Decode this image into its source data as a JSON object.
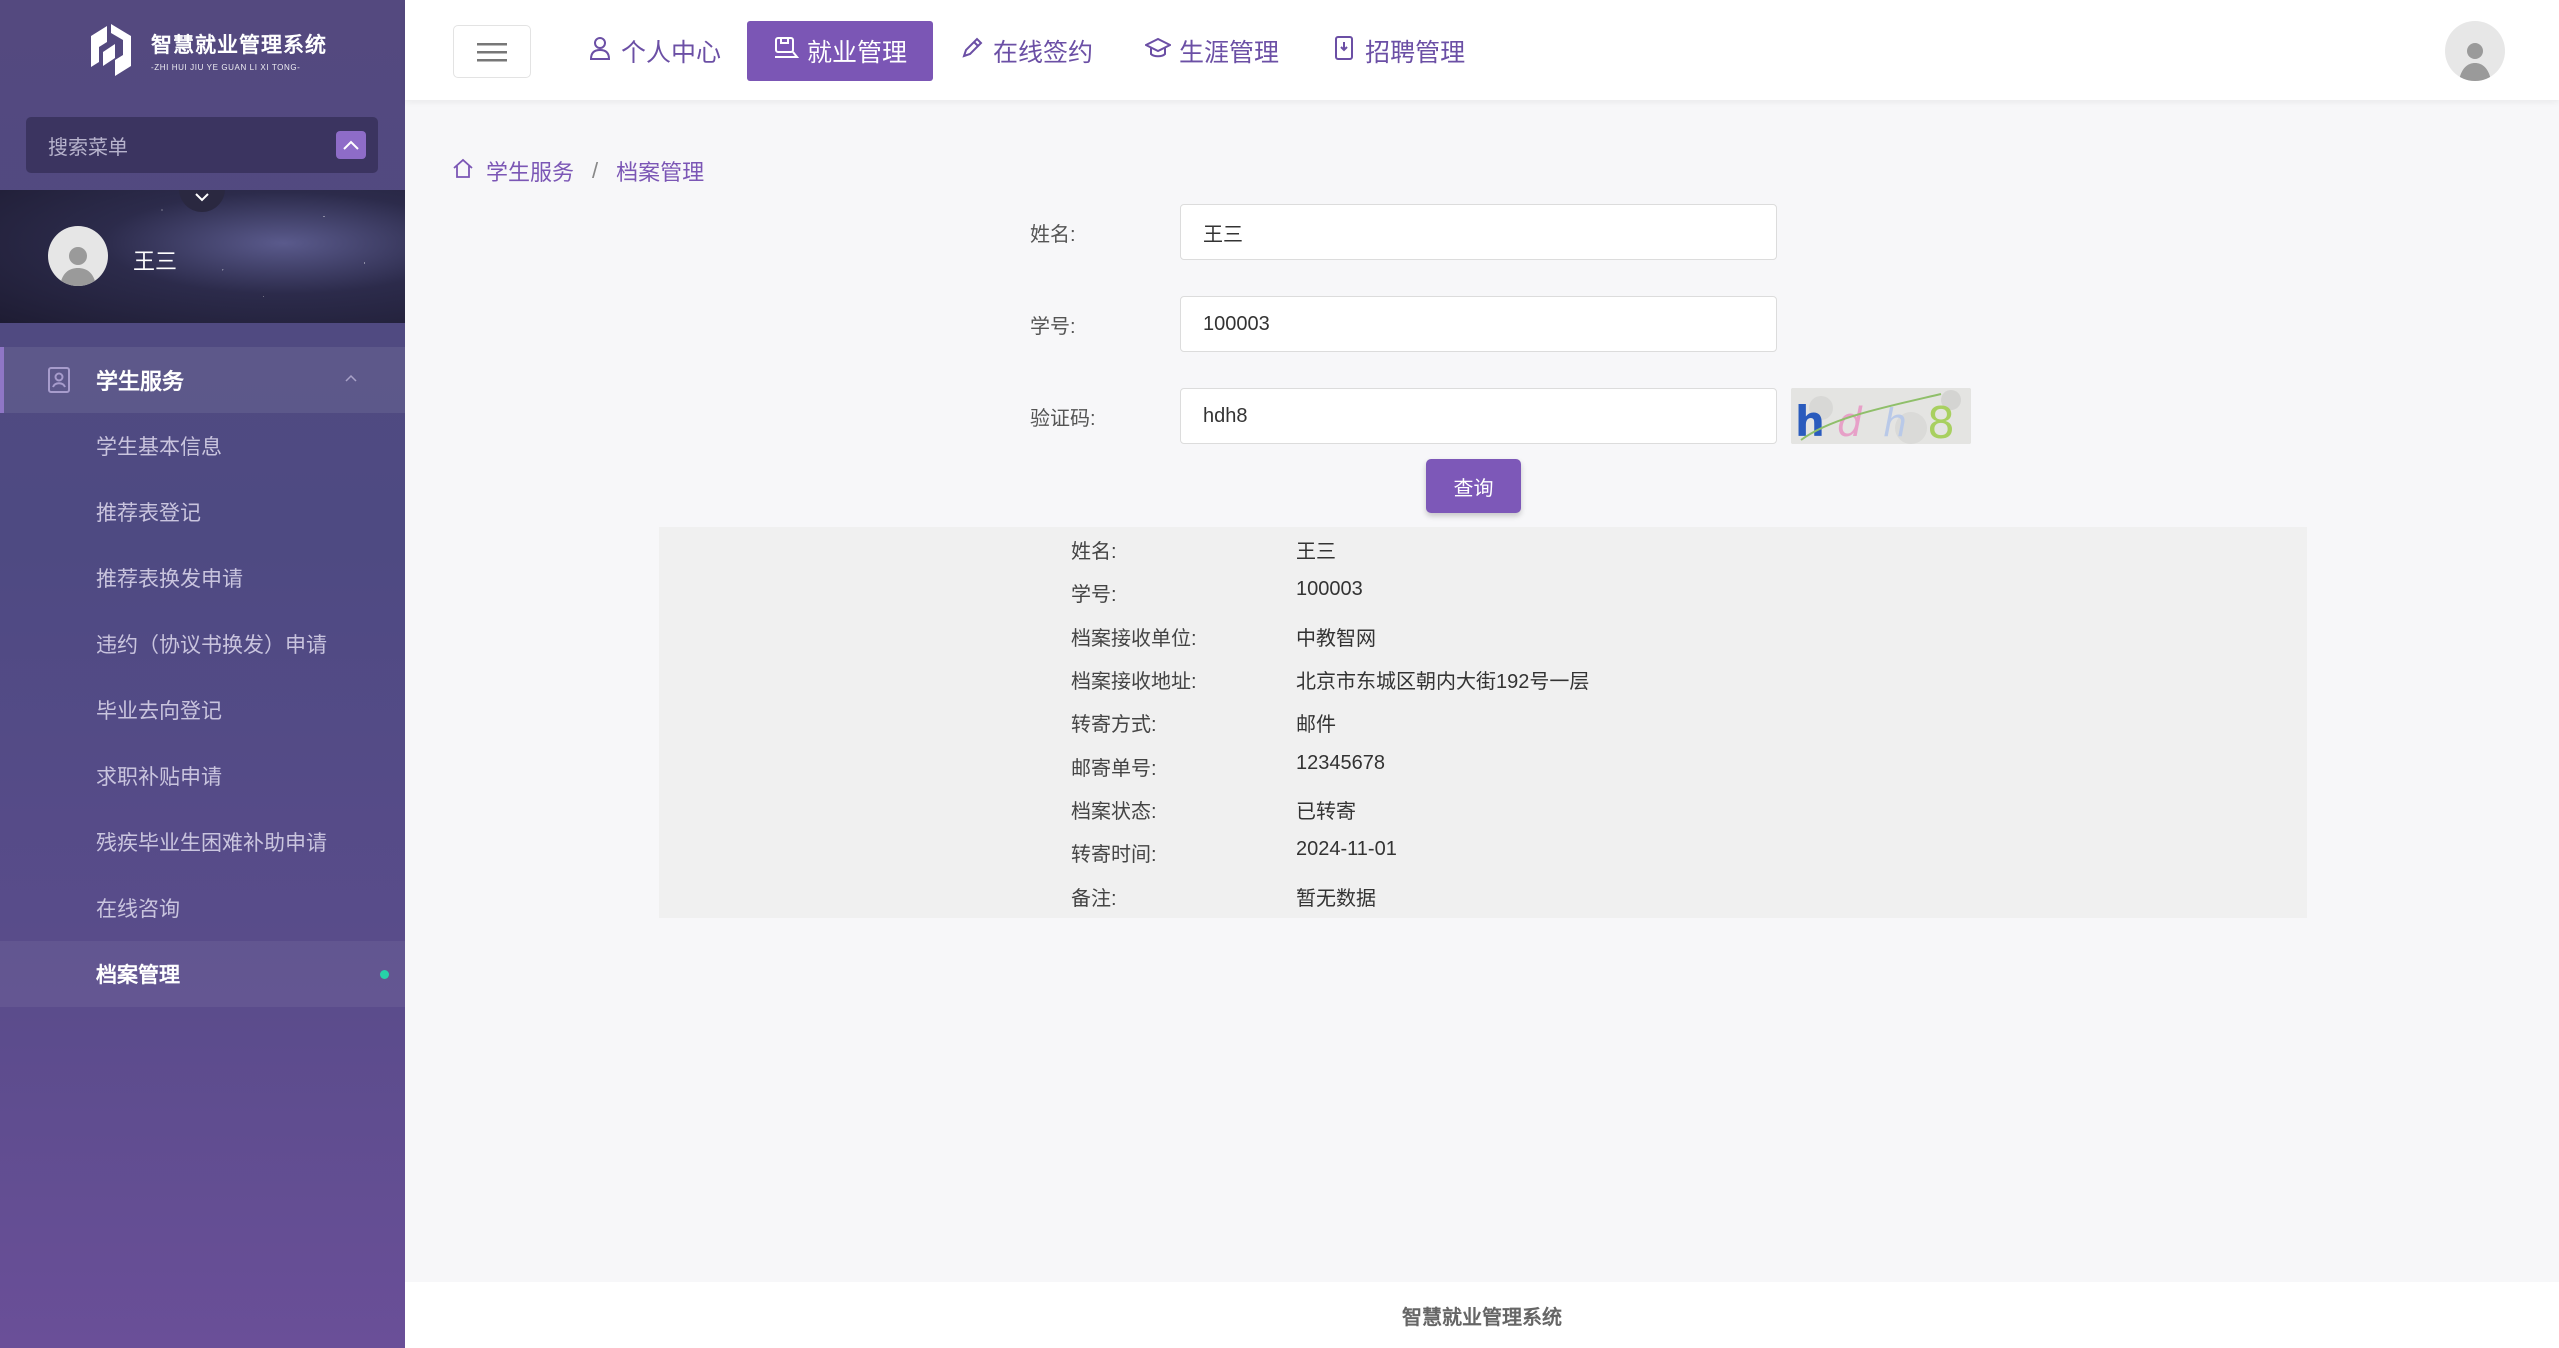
{
  "app": {
    "logo_title": "智慧就业管理系统",
    "logo_subtitle": "-ZHI HUI JIU YE GUAN LI XI TONG-"
  },
  "sidebar": {
    "search_placeholder": "搜索菜单",
    "user_name": "王三",
    "group_label": "学生服务",
    "items": [
      {
        "label": "学生基本信息"
      },
      {
        "label": "推荐表登记"
      },
      {
        "label": "推荐表换发申请"
      },
      {
        "label": "违约（协议书换发）申请"
      },
      {
        "label": "毕业去向登记"
      },
      {
        "label": "求职补贴申请"
      },
      {
        "label": "残疾毕业生困难补助申请"
      },
      {
        "label": "在线咨询"
      },
      {
        "label": "档案管理"
      }
    ],
    "active_item": "档案管理"
  },
  "topnav": {
    "tabs": [
      {
        "label": "个人中心",
        "icon": "user-icon"
      },
      {
        "label": "就业管理",
        "icon": "briefcase-icon"
      },
      {
        "label": "在线签约",
        "icon": "pencil-icon"
      },
      {
        "label": "生涯管理",
        "icon": "graduation-cap-icon"
      },
      {
        "label": "招聘管理",
        "icon": "document-icon"
      }
    ],
    "active_tab": "就业管理"
  },
  "breadcrumb": {
    "level1": "学生服务",
    "level2": "档案管理"
  },
  "form": {
    "name_label": "姓名:",
    "name_value": "王三",
    "id_label": "学号:",
    "id_value": "100003",
    "captcha_label": "验证码:",
    "captcha_value": "hdh8",
    "captcha_image_text": "hdh8",
    "query_button": "查询"
  },
  "result": {
    "rows": [
      {
        "key": "姓名:",
        "value": "王三"
      },
      {
        "key": "学号:",
        "value": "100003"
      },
      {
        "key": "档案接收单位:",
        "value": "中教智网"
      },
      {
        "key": "档案接收地址:",
        "value": "北京市东城区朝内大街192号一层"
      },
      {
        "key": "转寄方式:",
        "value": "邮件"
      },
      {
        "key": "邮寄单号:",
        "value": "12345678"
      },
      {
        "key": "档案状态:",
        "value": "已转寄"
      },
      {
        "key": "转寄时间:",
        "value": "2024-11-01"
      },
      {
        "key": "备注:",
        "value": "暂无数据"
      }
    ]
  },
  "footer": {
    "text": "智慧就业管理系统"
  },
  "colors": {
    "accent": "#7b56b5",
    "sidebar_bg": "#4e4a82",
    "online_dot": "#27d1a8"
  }
}
